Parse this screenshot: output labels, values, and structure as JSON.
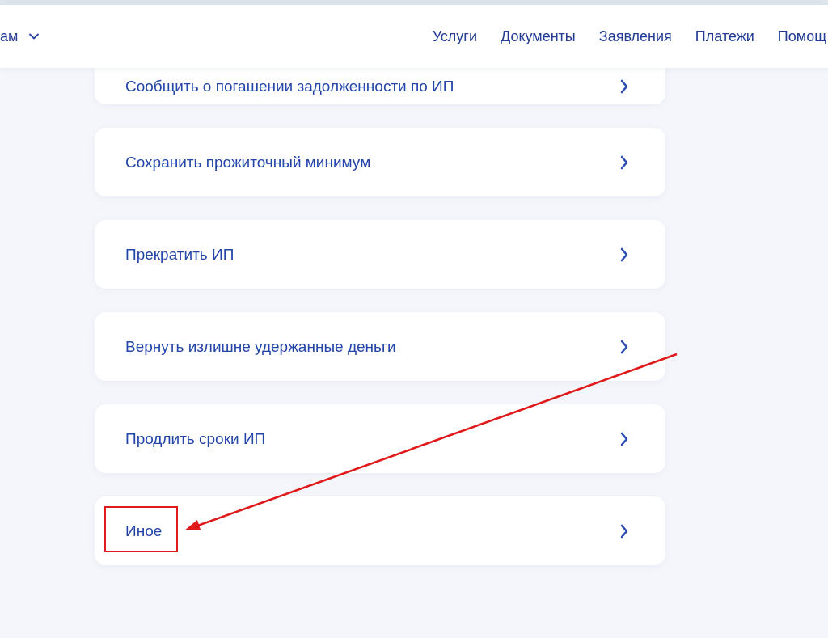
{
  "header": {
    "category_menu": {
      "label": "ам"
    },
    "nav": [
      {
        "label": "Услуги"
      },
      {
        "label": "Документы"
      },
      {
        "label": "Заявления"
      },
      {
        "label": "Платежи"
      },
      {
        "label": "Помощ"
      }
    ]
  },
  "items": [
    {
      "title": "Сообщить о погашении задолженности по ИП",
      "highlighted": false
    },
    {
      "title": "Сохранить прожиточный минимум",
      "highlighted": false
    },
    {
      "title": "Прекратить ИП",
      "highlighted": false
    },
    {
      "title": "Вернуть излишне удержанные деньги",
      "highlighted": false
    },
    {
      "title": "Продлить сроки ИП",
      "highlighted": false
    },
    {
      "title": "Иное",
      "highlighted": true
    }
  ]
}
